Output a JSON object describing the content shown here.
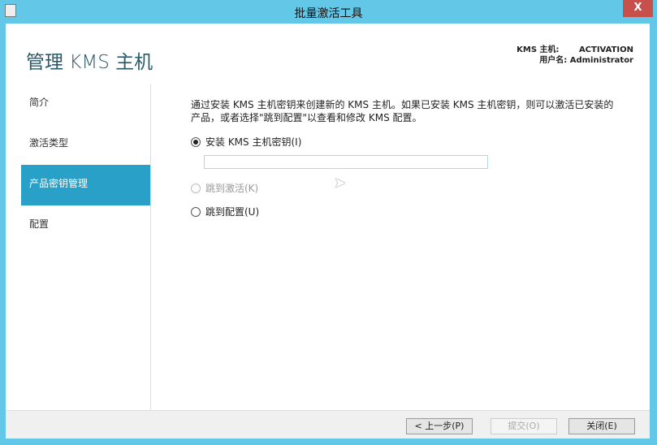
{
  "window": {
    "title": "批量激活工具",
    "close_label": "X"
  },
  "header": {
    "title": "管理 KMS 主机",
    "kms_host_label": "KMS 主机:",
    "kms_host_value": "ACTIVATION",
    "user_label": "用户名:",
    "user_value": "Administrator"
  },
  "sidebar": {
    "items": [
      {
        "label": "简介"
      },
      {
        "label": "激活类型"
      },
      {
        "label": "产品密钥管理"
      },
      {
        "label": "配置"
      }
    ]
  },
  "main": {
    "description": "通过安装 KMS 主机密钥来创建新的 KMS 主机。如果已安装 KMS 主机密钥，则可以激活已安装的产品，或者选择\"跳到配置\"以查看和修改 KMS 配置。",
    "options": [
      {
        "label": "安装 KMS 主机密钥(I)"
      },
      {
        "label": "跳到激活(K)"
      },
      {
        "label": "跳到配置(U)"
      }
    ],
    "key_value": ""
  },
  "footer": {
    "back": "< 上一步(P)",
    "submit": "提交(O)",
    "close": "关闭(E)"
  }
}
